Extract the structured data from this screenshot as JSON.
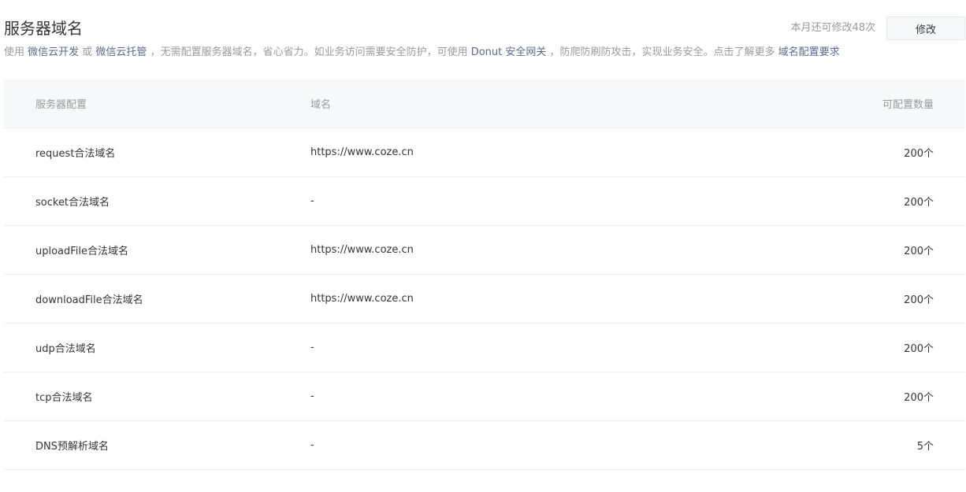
{
  "header": {
    "title": "服务器域名",
    "quota_text": "本月还可修改48次",
    "modify_label": "修改"
  },
  "description": {
    "prefix": "使用 ",
    "link1": "微信云开发",
    "or": " 或 ",
    "link2": "微信云托管",
    "middle": " ，无需配置服务器域名，省心省力。如业务访问需要安全防护，可使用 ",
    "link3": "Donut 安全网关",
    "after": " ，防爬防刷防攻击，实现业务安全。点击了解更多 ",
    "link4": "域名配置要求"
  },
  "table": {
    "columns": [
      "服务器配置",
      "域名",
      "可配置数量"
    ],
    "rows": [
      {
        "config": "request合法域名",
        "domain": "https://www.coze.cn",
        "quota": "200个"
      },
      {
        "config": "socket合法域名",
        "domain": "-",
        "quota": "200个"
      },
      {
        "config": "uploadFile合法域名",
        "domain": "https://www.coze.cn",
        "quota": "200个"
      },
      {
        "config": "downloadFile合法域名",
        "domain": "https://www.coze.cn",
        "quota": "200个"
      },
      {
        "config": "udp合法域名",
        "domain": "-",
        "quota": "200个"
      },
      {
        "config": "tcp合法域名",
        "domain": "-",
        "quota": "200个"
      },
      {
        "config": "DNS预解析域名",
        "domain": "-",
        "quota": "5个"
      }
    ]
  },
  "colors": {
    "link": "#576b95",
    "muted": "#9a9a9a",
    "text": "#353535",
    "header_bg": "#f6f8f9"
  }
}
